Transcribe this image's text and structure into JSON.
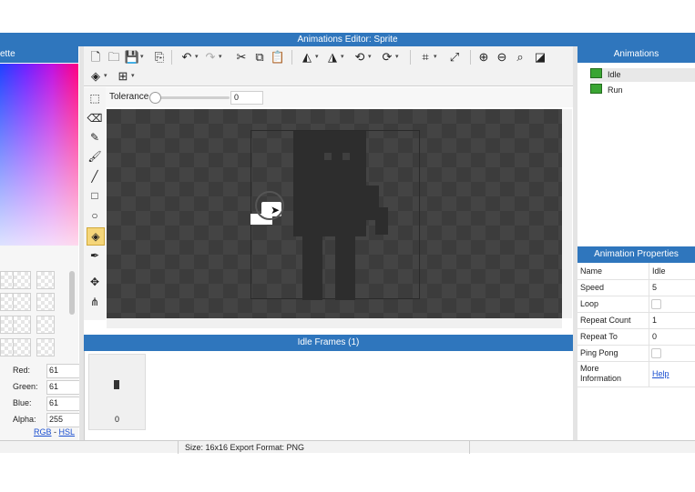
{
  "window": {
    "title": "Animations Editor: Sprite"
  },
  "palette": {
    "title_partial": "ette",
    "red_label": "Red:",
    "red": "61",
    "green_label": "Green:",
    "green": "61",
    "blue_label": "Blue:",
    "blue": "61",
    "alpha_label": "Alpha:",
    "alpha": "255",
    "rgb_link": "RGB",
    "link_sep": "-",
    "hsl_link": "HSL"
  },
  "toolbar": {
    "tolerance_label": "Tolerance",
    "tolerance_value": "0",
    "tolerance_fraction": 0
  },
  "tools": [
    "select-rect",
    "eraser",
    "pencil",
    "brush",
    "line",
    "rectangle",
    "ellipse",
    "fill-bucket",
    "eyedropper",
    "move-point",
    "skeleton"
  ],
  "selected_tool": "fill-bucket",
  "frames": {
    "header": "Idle Frames (1)",
    "items": [
      {
        "index": "0"
      }
    ]
  },
  "status": {
    "text": "Size: 16x16   Export Format: PNG"
  },
  "animations": {
    "header": "Animations",
    "items": [
      {
        "name": "Idle",
        "color": "#3aa533"
      },
      {
        "name": "Run",
        "color": "#3aa533"
      }
    ],
    "selected": "Idle"
  },
  "properties": {
    "header": "Animation Properties",
    "rows": [
      {
        "key": "Name",
        "value": "Idle"
      },
      {
        "key": "Speed",
        "value": "5"
      },
      {
        "key": "Loop",
        "checked": false
      },
      {
        "key": "Repeat Count",
        "value": "1"
      },
      {
        "key": "Repeat To",
        "value": "0"
      },
      {
        "key": "Ping Pong",
        "checked": false
      },
      {
        "key": "More Information",
        "link": "Help"
      }
    ]
  },
  "colors": {
    "accent": "#2f76bd",
    "canvas": "#3c3c3c",
    "sprite": "#2d2d2d",
    "anim_swatch": "#3aa533"
  }
}
